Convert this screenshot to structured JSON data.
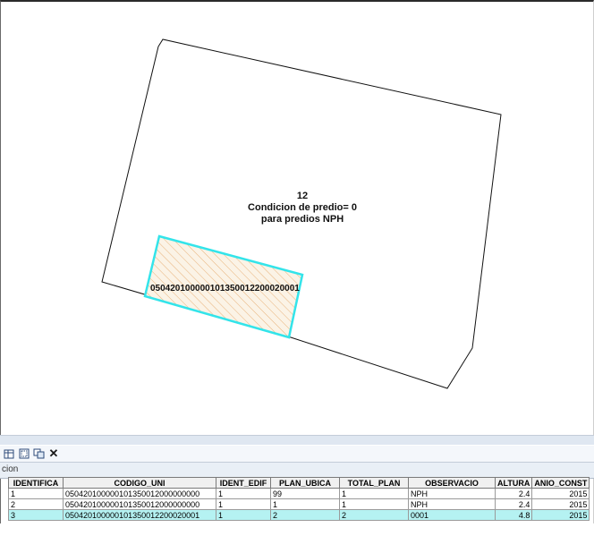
{
  "map": {
    "label_lines": [
      "12",
      "Condicion de predio= 0",
      "para predios  NPH"
    ],
    "parcel_code": "050420100000101350012200020001",
    "colors": {
      "outline": "#111111",
      "highlight": "#33e4ea",
      "hatch": "#e8b27a",
      "hatch_bg": "#fbf3e6"
    }
  },
  "toolbar": {
    "icons": [
      "table-options-icon",
      "select-by-attributes-icon",
      "relate-icon",
      "delete-icon"
    ]
  },
  "tab": {
    "label": "cion"
  },
  "table": {
    "columns": [
      "IDENTIFICA",
      "CODIGO_UNI",
      "IDENT_EDIF",
      "PLAN_UBICA",
      "TOTAL_PLAN",
      "OBSERVACIO",
      "ALTURA",
      "ANIO_CONST"
    ],
    "rows": [
      {
        "cells": [
          "1",
          "050420100000101350012000000000",
          "1",
          "99",
          "1",
          "NPH",
          "2.4",
          "2015"
        ],
        "selected": false
      },
      {
        "cells": [
          "2",
          "050420100000101350012000000000",
          "1",
          "1",
          "1",
          "NPH",
          "2.4",
          "2015"
        ],
        "selected": false
      },
      {
        "cells": [
          "3",
          "050420100000101350012200020001",
          "1",
          "2",
          "2",
          "0001",
          "4.8",
          "2015"
        ],
        "selected": true
      }
    ]
  }
}
